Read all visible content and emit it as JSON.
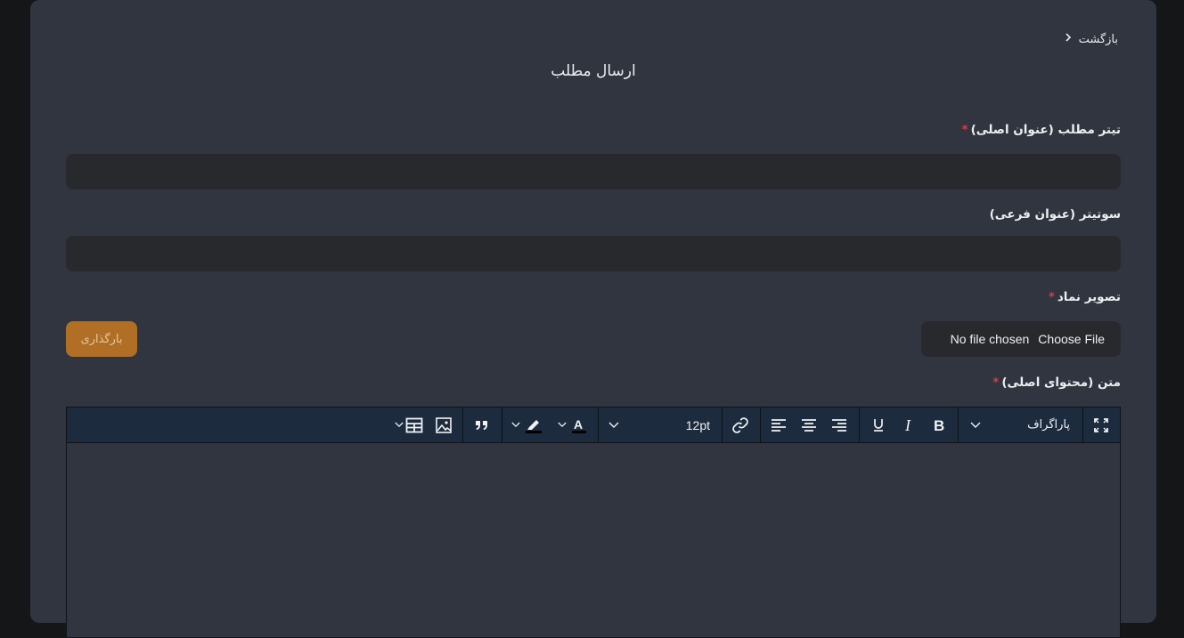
{
  "header": {
    "back_label": "بازگشت",
    "page_title": "ارسال مطلب"
  },
  "form": {
    "title_label": "تیتر مطلب (عنوان اصلی)",
    "title_value": "",
    "subtitle_label": "سوتیتر (عنوان فرعی)",
    "subtitle_value": "",
    "image_label": "تصویر نماد",
    "file_status": "No file chosen",
    "choose_file_label": "Choose File",
    "upload_label": "بارگذاری",
    "content_label": "متن (محتوای اصلی)",
    "required_mark": "*"
  },
  "editor": {
    "block_format": "پاراگراف",
    "font_size": "12pt",
    "icons": [
      "fullscreen-icon",
      "bold-icon",
      "italic-icon",
      "underline-icon",
      "align-right-icon",
      "align-center-icon",
      "align-left-icon",
      "link-icon",
      "text-color-icon",
      "highlight-icon",
      "blockquote-icon",
      "image-icon",
      "table-icon"
    ]
  }
}
